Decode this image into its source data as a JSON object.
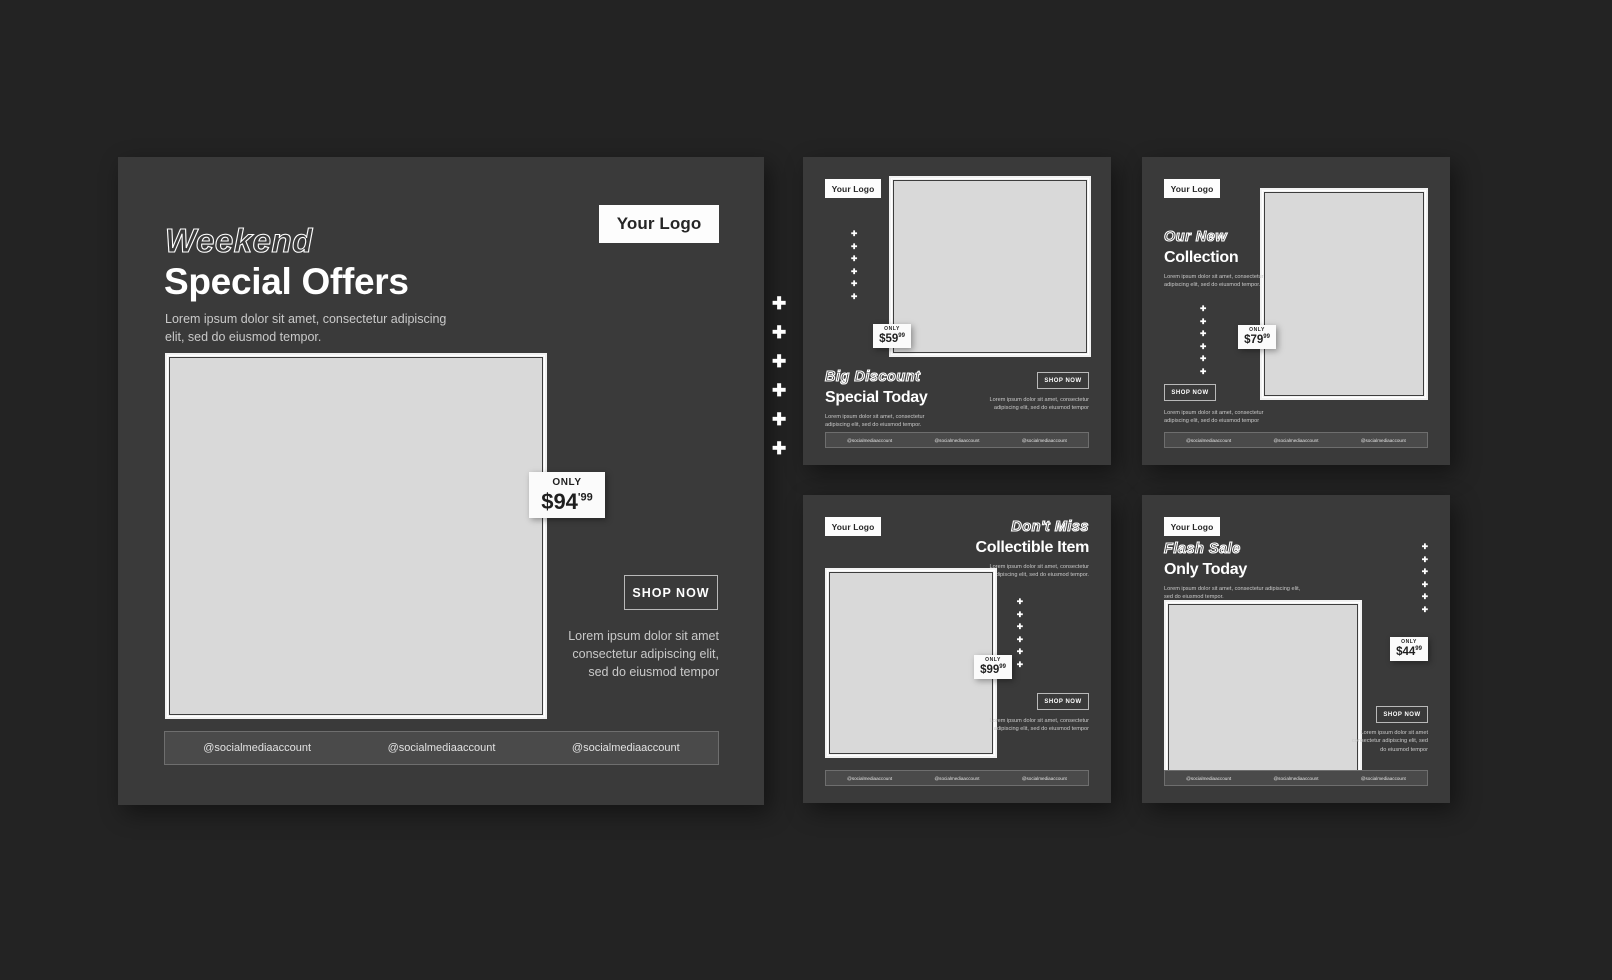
{
  "palette": {
    "page_background": "#232323",
    "card_background": "#3a3a3a",
    "badge_white": "#fdfdfd",
    "placeholder_gray": "#d9d9d9",
    "body_text": "#c9c9c9",
    "social_bar": "#4a4a4a"
  },
  "icons": {
    "sparkle": "✚"
  },
  "hero": {
    "logo": "Your Logo",
    "title_outline": "Weekend",
    "title_solid": "Special Offers",
    "body": "Lorem ipsum dolor sit amet, consectetur adipiscing elit, sed do eiusmod tempor.",
    "price": {
      "only_label": "ONLY",
      "amount": "$94",
      "cents": "'99"
    },
    "shop_button": "SHOP NOW",
    "cta_body": "Lorem ipsum dolor sit amet consectetur adipiscing elit, sed do eiusmod tempor",
    "sparkle_count": 6,
    "social": [
      "@socialmediaaccount",
      "@socialmediaaccount",
      "@socialmediaaccount"
    ]
  },
  "cards": [
    {
      "id": "card1",
      "logo": "Your Logo",
      "title_outline": "Big Discount",
      "title_solid": "Special Today",
      "body": "Lorem ipsum dolor sit amet, consectetur adipiscing elit, sed do eiusmod tempor.",
      "price": {
        "only_label": "ONLY",
        "amount": "$59",
        "cents": "99"
      },
      "shop_button": "SHOP NOW",
      "cta_body": "Lorem ipsum dolor sit amet, consectetur adipiscing elit, sed do eiusmod tempor",
      "sparkle_count": 6,
      "social": [
        "@socialmediaaccount",
        "@socialmediaaccount",
        "@socialmediaaccount"
      ]
    },
    {
      "id": "card2",
      "logo": "Your Logo",
      "title_outline": "Our New",
      "title_solid": "Collection",
      "body": "Lorem ipsum dolor sit amet, consectetur adipiscing elit, sed do eiusmod tempor.",
      "price": {
        "only_label": "ONLY",
        "amount": "$79",
        "cents": "99"
      },
      "shop_button": "SHOP NOW",
      "cta_body": "Lorem ipsum dolor sit amet, consectetur adipiscing elit, sed do eiusmod tempor",
      "sparkle_count": 6,
      "social": [
        "@socialmediaaccount",
        "@socialmediaaccount",
        "@socialmediaaccount"
      ]
    },
    {
      "id": "card3",
      "logo": "Your Logo",
      "title_outline": "Don't Miss",
      "title_solid": "Collectible Item",
      "body": "Lorem ipsum dolor sit amet, consectetur adipiscing elit, sed do eiusmod tempor.",
      "price": {
        "only_label": "ONLY",
        "amount": "$99",
        "cents": "99"
      },
      "shop_button": "SHOP NOW",
      "cta_body": "Lorem ipsum dolor sit amet, consectetur adipiscing elit, sed do eiusmod tempor",
      "sparkle_count": 6,
      "social": [
        "@socialmediaaccount",
        "@socialmediaaccount",
        "@socialmediaaccount"
      ]
    },
    {
      "id": "card4",
      "logo": "Your Logo",
      "title_outline": "Flash Sale",
      "title_solid": "Only Today",
      "body": "Lorem ipsum dolor sit amet, consectetur adipiscing elit, sed do eiusmod tempor.",
      "price": {
        "only_label": "ONLY",
        "amount": "$44",
        "cents": "99"
      },
      "shop_button": "SHOP NOW",
      "cta_body": "Lorem ipsum dolor sit amet consectetur adipiscing elit, sed do eiusmod tempor",
      "sparkle_count": 6,
      "social": [
        "@socialmediaaccount",
        "@socialmediaaccount",
        "@socialmediaaccount"
      ]
    }
  ]
}
